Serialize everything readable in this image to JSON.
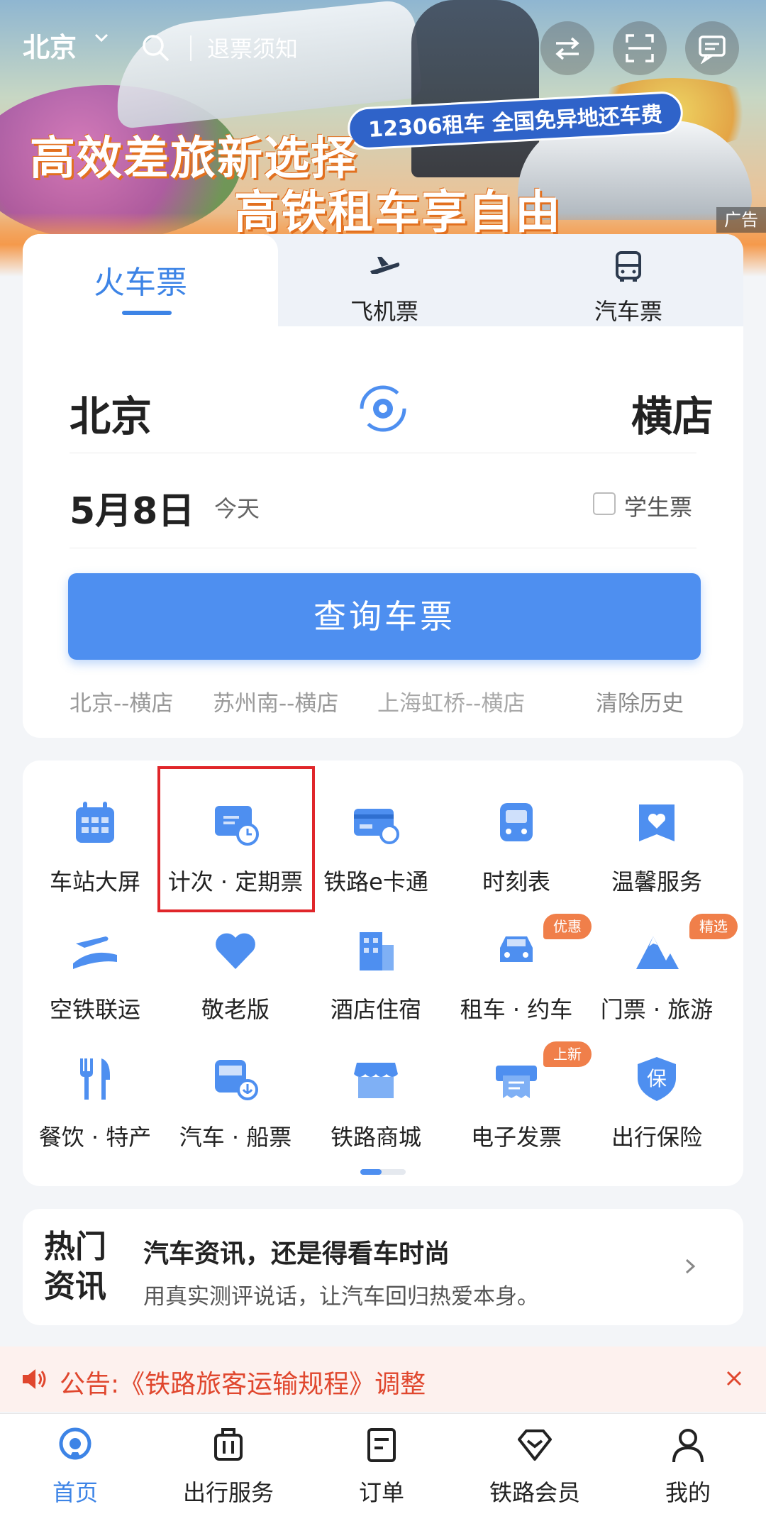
{
  "banner": {
    "headline1": "高效差旅新选择",
    "headline2": "高铁租车享自由",
    "pill": "12306租车 全国免异地还车费",
    "ad_tag": "广告"
  },
  "topbar": {
    "city": "北京",
    "search_text": "退票须知"
  },
  "ticket_tabs": {
    "train": "火车票",
    "plane": "飞机票",
    "bus": "汽车票"
  },
  "route": {
    "from": "北京",
    "to": "横店",
    "date": "5月8日",
    "date_hint": "今天",
    "student_label": "学生票",
    "query_button": "查询车票"
  },
  "history": {
    "items": [
      "北京--横店",
      "苏州南--横店",
      "上海虹桥--横店"
    ],
    "clear": "清除历史"
  },
  "services": [
    {
      "label": "车站大屏",
      "icon": "station-screen-icon"
    },
    {
      "label": "计次 · 定期票",
      "icon": "period-ticket-icon"
    },
    {
      "label": "铁路e卡通",
      "icon": "rail-ecard-icon"
    },
    {
      "label": "时刻表",
      "icon": "timetable-icon"
    },
    {
      "label": "温馨服务",
      "icon": "warm-service-icon"
    },
    {
      "label": "空铁联运",
      "icon": "air-rail-icon"
    },
    {
      "label": "敬老版",
      "icon": "heart-icon"
    },
    {
      "label": "酒店住宿",
      "icon": "hotel-icon"
    },
    {
      "label": "租车 · 约车",
      "icon": "car-rental-icon",
      "badge": "优惠"
    },
    {
      "label": "门票 · 旅游",
      "icon": "mountain-icon",
      "badge": "精选"
    },
    {
      "label": "餐饮 · 特产",
      "icon": "dining-icon"
    },
    {
      "label": "汽车 · 船票",
      "icon": "bus-ship-icon"
    },
    {
      "label": "铁路商城",
      "icon": "mall-icon"
    },
    {
      "label": "电子发票",
      "icon": "invoice-icon",
      "badge": "上新"
    },
    {
      "label": "出行保险",
      "icon": "insurance-icon"
    }
  ],
  "news": {
    "badge": "热门资讯",
    "title": "汽车资讯，还是得看车时尚",
    "subtitle": "用真实测评说话，让汽车回归热爱本身。"
  },
  "notice": {
    "text": "公告:《铁路旅客运输规程》调整"
  },
  "tabbar": {
    "items": [
      "首页",
      "出行服务",
      "订单",
      "铁路会员",
      "我的"
    ],
    "active": "首页"
  },
  "colors": {
    "accent": "#3d84e6",
    "button": "#4e8ff0",
    "notice": "#e0472e",
    "badge": "#f07f4a",
    "highlight": "#e0262a"
  }
}
